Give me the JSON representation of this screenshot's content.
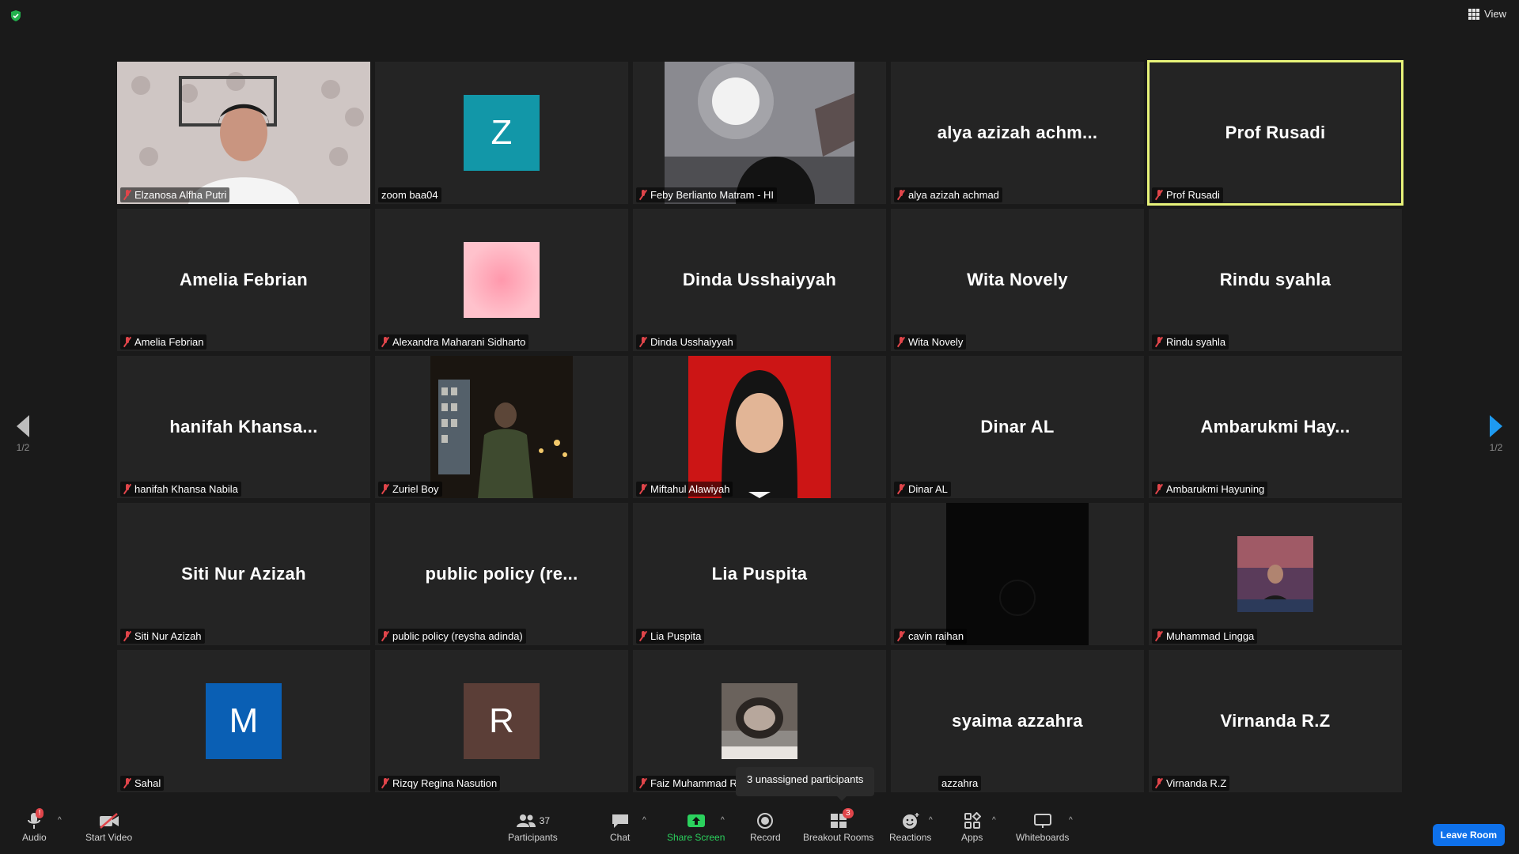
{
  "top": {
    "view_label": "View"
  },
  "paging": {
    "left_count": "1/2",
    "right_count": "1/2"
  },
  "tiles": [
    {
      "display": "video",
      "name": "Elzanosa Alfha Putri"
    },
    {
      "display": "letter",
      "letter": "Z",
      "letter_color": "#1297a8",
      "name": "zoom baa04"
    },
    {
      "display": "video",
      "name": "Feby Berlianto Matram - HI"
    },
    {
      "display": "text",
      "big": "alya azizah achm...",
      "name": "alya azizah achmad"
    },
    {
      "display": "text",
      "big": "Prof Rusadi",
      "name": "Prof Rusadi",
      "active": true
    },
    {
      "display": "text",
      "big": "Amelia Febrian",
      "name": "Amelia Febrian"
    },
    {
      "display": "picture",
      "name": "Alexandra Maharani Sidharto"
    },
    {
      "display": "text",
      "big": "Dinda Usshaiyyah",
      "name": "Dinda Usshaiyyah"
    },
    {
      "display": "text",
      "big": "Wita Novely",
      "name": "Wita Novely"
    },
    {
      "display": "text",
      "big": "Rindu syahla",
      "name": "Rindu syahla"
    },
    {
      "display": "text",
      "big": "hanifah  Khansa...",
      "name": "hanifah Khansa Nabila"
    },
    {
      "display": "video",
      "name": "Zuriel Boy"
    },
    {
      "display": "video",
      "name": "Miftahul Alawiyah"
    },
    {
      "display": "text",
      "big": "Dinar AL",
      "name": "Dinar AL"
    },
    {
      "display": "text",
      "big": "Ambarukmi  Hay...",
      "name": "Ambarukmi Hayuning"
    },
    {
      "display": "text",
      "big": "Siti Nur Azizah",
      "name": "Siti Nur Azizah"
    },
    {
      "display": "text",
      "big": "public  policy  (re...",
      "name": "public policy (reysha adinda)"
    },
    {
      "display": "text",
      "big": "Lia Puspita",
      "name": "Lia Puspita"
    },
    {
      "display": "video",
      "name": "cavin raihan"
    },
    {
      "display": "picture",
      "name": "Muhammad Lingga"
    },
    {
      "display": "letter",
      "letter": "M",
      "letter_color": "#0a5fb4",
      "name": "Sahal"
    },
    {
      "display": "letter",
      "letter": "R",
      "letter_color": "#5b3e37",
      "name": "Rizqy Regina Nasution"
    },
    {
      "display": "picture",
      "name": "Faiz Muhammad R"
    },
    {
      "display": "text",
      "big": "syaima azzahra",
      "name": "azzahra"
    },
    {
      "display": "text",
      "big": "Virnanda R.Z",
      "name": "Virnanda R.Z"
    }
  ],
  "toolbar": {
    "audio": "Audio",
    "audio_badge": "!",
    "start_video": "Start Video",
    "participants": "Participants",
    "participants_count": "37",
    "chat": "Chat",
    "share_screen": "Share Screen",
    "record": "Record",
    "breakout_rooms": "Breakout Rooms",
    "breakout_badge": "3",
    "reactions": "Reactions",
    "apps": "Apps",
    "whiteboards": "Whiteboards",
    "leave": "Leave Room",
    "tooltip": "3 unassigned participants"
  },
  "colors": {
    "accent_blue": "#0e71eb",
    "active_speaker": "#e8f37a",
    "share_green": "#2bd15d",
    "muted_red": "#e0454a"
  }
}
